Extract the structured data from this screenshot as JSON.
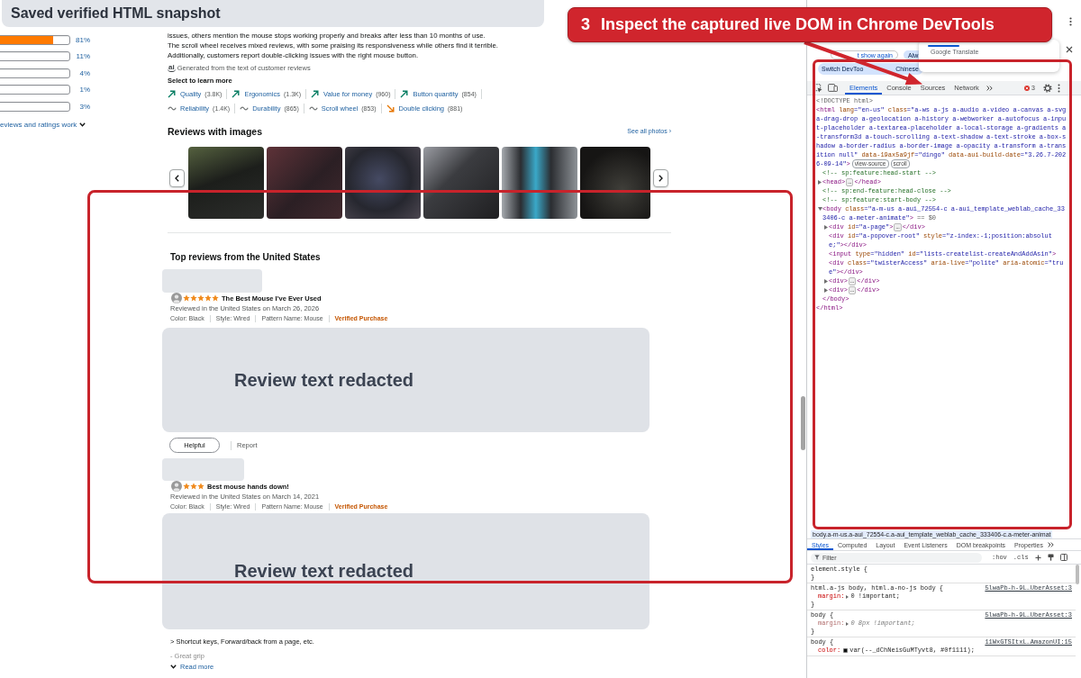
{
  "banner": {
    "title": "Saved verified HTML snapshot"
  },
  "callout": {
    "step": "3",
    "text": "Inspect the captured live DOM in Chrome DevTools"
  },
  "rating_histogram": {
    "bars": [
      {
        "level": 0.81,
        "percent": "81%"
      },
      {
        "level": 0.11,
        "percent": "11%"
      },
      {
        "level": 0.04,
        "percent": "4%"
      },
      {
        "level": 0.01,
        "percent": "1%"
      },
      {
        "level": 0.03,
        "percent": "3%"
      }
    ],
    "link": "eviews and ratings work"
  },
  "summary": {
    "text": "issues, others mention the mouse stops working properly and breaks after less than 10 months of use. The scroll wheel receives mixed reviews, with some praising its responsiveness while others find it terrible. Additionally, customers report double-clicking issues with the right mouse button.",
    "ai_mark": "ai",
    "source_note": "Generated from the text of customer reviews"
  },
  "aspects": {
    "heading": "Select to learn more",
    "rows": [
      [
        {
          "label": "Quality",
          "count": "(3.8K)",
          "kind": "positive"
        },
        {
          "label": "Ergonomics",
          "count": "(1.3K)",
          "kind": "positive"
        },
        {
          "label": "Value for money",
          "count": "(960)",
          "kind": "positive"
        },
        {
          "label": "Button quantity",
          "count": "(854)",
          "kind": "positive"
        }
      ],
      [
        {
          "label": "Reliability",
          "count": "(1.4K)",
          "kind": "neutral"
        },
        {
          "label": "Durability",
          "count": "(865)",
          "kind": "neutral"
        },
        {
          "label": "Scroll wheel",
          "count": "(853)",
          "kind": "neutral"
        },
        {
          "label": "Double clicking",
          "count": "(881)",
          "kind": "negative"
        }
      ]
    ]
  },
  "image_reviews": {
    "heading": "Reviews with images",
    "link": "See all photos ›"
  },
  "top_reviews": {
    "heading": "Top reviews from the United States",
    "reviews": [
      {
        "name_redacted": true,
        "stars": 5,
        "title": "The Best Mouse I've Ever Used",
        "date": "Reviewed in the United States on March 26, 2026",
        "variants": [
          "Color: Black",
          "Style: Wired",
          "Pattern Name: Mouse"
        ],
        "verified": "Verified Purchase",
        "body": "Review text redacted",
        "helpful": "Helpful",
        "report": "Report"
      },
      {
        "name_redacted": true,
        "stars": 3,
        "title": "Best mouse hands down!",
        "date": "Reviewed in the United States on March 14, 2021",
        "variants": [
          "Color: Black",
          "Style: Wired",
          "Pattern Name: Mouse"
        ],
        "verified": "Verified Purchase",
        "body": "Review text redacted",
        "excerpt": [
          {
            "text": "> Shortcut keys, Forward/back from a page, etc.",
            "faded": false
          },
          {
            "text": "- Great grip",
            "faded": true
          }
        ],
        "read_more": "Read more"
      }
    ]
  },
  "devtools": {
    "infobar": {
      "rows": [
        [
          {
            "parts": [
              "t show again"
            ],
            "kind": "outlined"
          },
          {
            "parts": [
              "Alw"
            ],
            "kind": "tonal"
          }
        ],
        [
          {
            "parts": [
              "Switch DevToo",
              "Chinese"
            ],
            "kind": "tonal"
          }
        ]
      ]
    },
    "translate_popup": {
      "label": "Google Translate"
    },
    "panel_tabs": [
      {
        "label": "Elements",
        "selected": true
      },
      {
        "label": "Console",
        "selected": false
      },
      {
        "label": "Sources",
        "selected": false
      },
      {
        "label": "Network",
        "selected": false
      }
    ],
    "error_count": "3",
    "dom_tree": [
      {
        "parts": [
          {
            "kind": "doctype",
            "text": "<!DOCTYPE html>"
          }
        ]
      },
      {
        "parts": [
          {
            "kind": "tag",
            "text": "<html"
          },
          {
            "kind": "attr",
            "text": " lang"
          },
          {
            "kind": "value",
            "text": "=\"en-us\""
          },
          {
            "kind": "attr",
            "text": " class"
          },
          {
            "kind": "value",
            "text": "=\"a-ws a-js a-audio a-video a-canvas a-svg a-drag-drop a-geolocation a-history a-webworker a-autofocus a-input-placeholder a-textarea-placeholder a-local-storage a-gradients a-transform3d a-touch-scrolling a-text-shadow a-text-stroke a-box-shadow a-border-radius a-border-image a-opacity a-transform a-transition null\""
          },
          {
            "kind": "attr",
            "text": " data-19ax5a9jf"
          },
          {
            "kind": "value",
            "text": "=\"dingo\""
          },
          {
            "kind": "attr",
            "text": " data-aui-build-date"
          },
          {
            "kind": "value",
            "text": "=\"3.26.7-2026-09-14\""
          },
          {
            "kind": "tag",
            "text": ">"
          }
        ],
        "badges": [
          "view-source",
          "scroll"
        ],
        "children": [
          {
            "parts": [
              {
                "kind": "comment",
                "text": "<!-- sp:feature:head-start -->"
              }
            ]
          },
          {
            "parts": [
              {
                "kind": "tag",
                "text": "<head>"
              }
            ],
            "expanded": false,
            "placeholder": "…",
            "close": [
              {
                "kind": "tag",
                "text": "</head>"
              }
            ]
          },
          {
            "parts": [
              {
                "kind": "comment",
                "text": "<!-- sp:end-feature:head-close -->"
              }
            ]
          },
          {
            "parts": [
              {
                "kind": "comment",
                "text": "<!-- sp:feature:start-body -->"
              }
            ]
          },
          {
            "parts": [
              {
                "kind": "tag",
                "text": "<body"
              },
              {
                "kind": "attr",
                "text": " class"
              },
              {
                "kind": "value",
                "text": "=\"a-m-us a-aui_72554-c a-aui_template_weblab_cache_333406-c a-meter-animate\""
              },
              {
                "kind": "tag",
                "text": ">"
              },
              {
                "kind": "plain",
                "text": " == $0"
              }
            ],
            "expanded": true,
            "children": [
              {
                "parts": [
                  {
                    "kind": "tag",
                    "text": "<div"
                  },
                  {
                    "kind": "attr",
                    "text": " id"
                  },
                  {
                    "kind": "value",
                    "text": "=\"a-page\""
                  },
                  {
                    "kind": "tag",
                    "text": ">"
                  }
                ],
                "expanded": false,
                "placeholder": "…",
                "close": [
                  {
                    "kind": "tag",
                    "text": "</div>"
                  }
                ]
              },
              {
                "parts": [
                  {
                    "kind": "tag",
                    "text": "<div"
                  },
                  {
                    "kind": "attr",
                    "text": " id"
                  },
                  {
                    "kind": "value",
                    "text": "=\"a-popover-root\""
                  },
                  {
                    "kind": "attr",
                    "text": " style"
                  },
                  {
                    "kind": "value",
                    "text": "=\"z-index:-1;position:absolute;\""
                  },
                  {
                    "kind": "tag",
                    "text": "></div>"
                  }
                ]
              },
              {
                "parts": [
                  {
                    "kind": "tag",
                    "text": "<input"
                  },
                  {
                    "kind": "attr",
                    "text": " type"
                  },
                  {
                    "kind": "value",
                    "text": "=\"hidden\""
                  },
                  {
                    "kind": "attr",
                    "text": " id"
                  },
                  {
                    "kind": "value",
                    "text": "=\"lists-createlist-createAndAddAsin\""
                  },
                  {
                    "kind": "tag",
                    "text": ">"
                  }
                ]
              },
              {
                "parts": [
                  {
                    "kind": "tag",
                    "text": "<div"
                  },
                  {
                    "kind": "attr",
                    "text": " class"
                  },
                  {
                    "kind": "value",
                    "text": "=\"twisterAccess\""
                  },
                  {
                    "kind": "attr",
                    "text": " aria-live"
                  },
                  {
                    "kind": "value",
                    "text": "=\"polite\""
                  },
                  {
                    "kind": "attr",
                    "text": " aria-atomic"
                  },
                  {
                    "kind": "value",
                    "text": "=\"true\""
                  },
                  {
                    "kind": "tag",
                    "text": "></div>"
                  }
                ]
              },
              {
                "parts": [
                  {
                    "kind": "tag",
                    "text": "<div>"
                  }
                ],
                "expanded": false,
                "placeholder": "…",
                "close": [
                  {
                    "kind": "tag",
                    "text": "</div>"
                  }
                ]
              },
              {
                "parts": [
                  {
                    "kind": "tag",
                    "text": "<div>"
                  }
                ],
                "expanded": false,
                "placeholder": "…",
                "close": [
                  {
                    "kind": "tag",
                    "text": "</div>"
                  }
                ]
              }
            ],
            "close": [
              {
                "kind": "tag",
                "text": "</body>"
              }
            ]
          }
        ],
        "close": [
          {
            "kind": "tag",
            "text": "</html>"
          }
        ]
      }
    ],
    "breadcrumb": "body.a-m-us.a-aui_72554-c.a-aui_template_weblab_cache_333406-c.a-meter-animat",
    "sidebar_tabs": [
      {
        "label": "Styles",
        "selected": true
      },
      {
        "label": "Computed",
        "selected": false
      },
      {
        "label": "Layout",
        "selected": false
      },
      {
        "label": "Event Listeners",
        "selected": false
      },
      {
        "label": "DOM breakpoints",
        "selected": false
      },
      {
        "label": "Properties",
        "selected": false
      }
    ],
    "filter": {
      "placeholder": "Filter",
      "toggles": [
        ":hov",
        ".cls"
      ]
    },
    "rules": [
      {
        "selector": "element.style {",
        "end": "}"
      },
      {
        "selector": "html.a-js body, html.a-no-js body {",
        "source": "5lwaPb-h-9L…UberAsset:3",
        "declarations": [
          {
            "property": "margin:",
            "value": "0 !important;",
            "expandable": true,
            "overridden": false
          }
        ],
        "end": "}"
      },
      {
        "selector": "body {",
        "source": "5lwaPb-h-9L…UberAsset:3",
        "declarations": [
          {
            "property": "margin:",
            "value": "0 8px !important;",
            "expandable": true,
            "overridden": true
          }
        ],
        "end": "}"
      },
      {
        "selector": "body {",
        "source": "11WxGTSItxL…AmazonUI:15",
        "declarations": [
          {
            "property": "color:",
            "value": "var(--_dChNeisGuMTyvt8, #0f1111);",
            "swatch": true,
            "overridden": false
          }
        ]
      }
    ]
  }
}
